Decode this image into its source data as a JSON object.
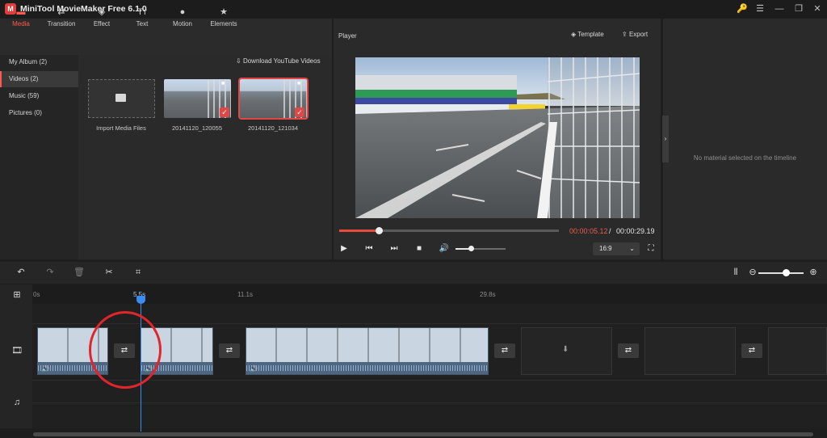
{
  "app": {
    "title": "MiniTool MovieMaker Free 6.1.0",
    "logo": "M"
  },
  "window_controls": {
    "key_icon": "🔑",
    "menu_icon": "☰",
    "minimize": "—",
    "restore": "❐",
    "close": "✕"
  },
  "media_tabs": [
    {
      "label": "Media",
      "icon": "▬",
      "active": true
    },
    {
      "label": "Transition",
      "icon": "⇄"
    },
    {
      "label": "Effect",
      "icon": "◈"
    },
    {
      "label": "Text",
      "icon": "Tт"
    },
    {
      "label": "Motion",
      "icon": "●"
    },
    {
      "label": "Elements",
      "icon": "★"
    }
  ],
  "categories": [
    {
      "label": "My Album  (2)"
    },
    {
      "label": "Videos  (2)",
      "active": true
    },
    {
      "label": "Music  (59)"
    },
    {
      "label": "Pictures  (0)"
    }
  ],
  "download_youtube": "Download YouTube Videos",
  "media_items": [
    {
      "label": "Import Media Files"
    },
    {
      "label": "20141120_120055"
    },
    {
      "label": "20141120_121034"
    }
  ],
  "player": {
    "title": "Player",
    "template_label": "Template",
    "export_label": "Export",
    "progress_fraction": 0.18,
    "time_current": "00:00:05.12",
    "time_separator": "/",
    "time_total": "00:00:29.19",
    "volume_fraction": 0.3,
    "aspect_ratio": "16:9",
    "controls": {
      "play": "▶",
      "prev": "⏮",
      "next": "⏭",
      "stop": "■",
      "volume": "🔊",
      "fullscreen": "⛶"
    }
  },
  "properties": {
    "empty_text": "No material selected on the timeline",
    "collapse_icon": "›"
  },
  "timeline_toolbar": {
    "undo": "↶",
    "redo": "↷",
    "delete": "🗑",
    "split": "✂",
    "crop": "⌗",
    "fit": "⦀",
    "zoom_out": "⊖",
    "zoom_in": "⊕",
    "zoom_fraction": 0.6
  },
  "ruler_ticks": [
    {
      "label": "0s"
    },
    {
      "label": "5.5s",
      "active": true
    },
    {
      "label": "11.1s"
    },
    {
      "label": "29.8s"
    }
  ],
  "track_icons": {
    "add": "⊞",
    "video": "🎞",
    "audio": "♫"
  },
  "transition_icon": "⇄",
  "speaker_icon": "🔊",
  "empty_slot_icon": "⬇",
  "colors": {
    "accent": "#ff5a4d",
    "time": "#f05a4a",
    "playhead": "#3b8cf0",
    "annotation": "#e0262b"
  }
}
